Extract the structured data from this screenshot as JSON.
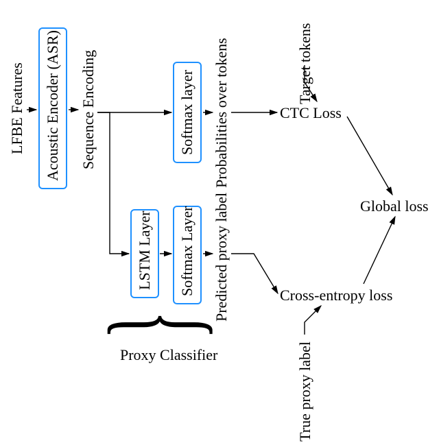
{
  "labels": {
    "lfbe": "LFBE Features",
    "encoder": "Acoustic Encoder (ASR)",
    "seq_encoding": "Sequence Encoding",
    "softmax_top": "Softmax layer",
    "lstm": "LSTM Layer",
    "softmax_bot": "Softmax Layer",
    "probs": "Probabilities over tokens",
    "pred_proxy": "Predicted proxy label",
    "ctc_loss": "CTC Loss",
    "ce_loss": "Cross-entropy loss",
    "target_tokens": "Target tokens",
    "true_proxy": "True proxy label",
    "global_loss": "Global loss",
    "proxy_classifier": "Proxy Classifier"
  },
  "chart_data": {
    "type": "diagram",
    "components": [
      {
        "id": "lfbe",
        "kind": "input",
        "label": "LFBE Features"
      },
      {
        "id": "encoder",
        "kind": "block",
        "label": "Acoustic Encoder (ASR)"
      },
      {
        "id": "seq_encoding",
        "kind": "signal",
        "label": "Sequence Encoding"
      },
      {
        "id": "softmax_top",
        "kind": "block",
        "label": "Softmax layer"
      },
      {
        "id": "probs",
        "kind": "signal",
        "label": "Probabilities over tokens"
      },
      {
        "id": "target_tokens",
        "kind": "input",
        "label": "Target tokens"
      },
      {
        "id": "ctc_loss",
        "kind": "loss",
        "label": "CTC Loss"
      },
      {
        "id": "lstm",
        "kind": "block",
        "label": "LSTM Layer",
        "group": "proxy_classifier"
      },
      {
        "id": "softmax_bot",
        "kind": "block",
        "label": "Softmax Layer",
        "group": "proxy_classifier"
      },
      {
        "id": "pred_proxy",
        "kind": "signal",
        "label": "Predicted proxy label"
      },
      {
        "id": "true_proxy",
        "kind": "input",
        "label": "True proxy label"
      },
      {
        "id": "ce_loss",
        "kind": "loss",
        "label": "Cross-entropy loss"
      },
      {
        "id": "global_loss",
        "kind": "output",
        "label": "Global loss"
      }
    ],
    "groups": [
      {
        "id": "proxy_classifier",
        "label": "Proxy Classifier",
        "members": [
          "lstm",
          "softmax_bot"
        ]
      }
    ],
    "edges": [
      {
        "from": "lfbe",
        "to": "encoder"
      },
      {
        "from": "encoder",
        "to": "seq_encoding"
      },
      {
        "from": "seq_encoding",
        "to": "softmax_top"
      },
      {
        "from": "softmax_top",
        "to": "probs"
      },
      {
        "from": "probs",
        "to": "ctc_loss"
      },
      {
        "from": "target_tokens",
        "to": "ctc_loss"
      },
      {
        "from": "seq_encoding",
        "to": "lstm"
      },
      {
        "from": "lstm",
        "to": "softmax_bot"
      },
      {
        "from": "softmax_bot",
        "to": "pred_proxy"
      },
      {
        "from": "pred_proxy",
        "to": "ce_loss"
      },
      {
        "from": "true_proxy",
        "to": "ce_loss"
      },
      {
        "from": "ctc_loss",
        "to": "global_loss"
      },
      {
        "from": "ce_loss",
        "to": "global_loss"
      }
    ]
  }
}
